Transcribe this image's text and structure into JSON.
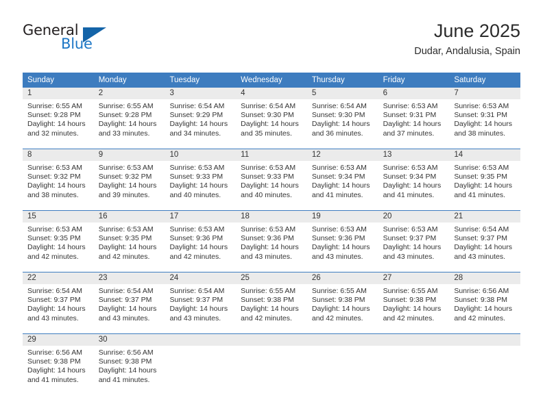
{
  "brand": {
    "name_primary": "General",
    "name_secondary": "Blue",
    "triangle_icon": "triangle-icon",
    "accent_color": "#1c76c5"
  },
  "header": {
    "title": "June 2025",
    "subtitle": "Dudar, Andalusia, Spain"
  },
  "colors": {
    "header_blue": "#3d7cbf",
    "day_band_gray": "#ebebeb",
    "text": "#333333"
  },
  "weekdays": [
    "Sunday",
    "Monday",
    "Tuesday",
    "Wednesday",
    "Thursday",
    "Friday",
    "Saturday"
  ],
  "labels": {
    "sunrise": "Sunrise:",
    "sunset": "Sunset:",
    "daylight": "Daylight:"
  },
  "weeks": [
    [
      {
        "day": "1",
        "sunrise": "Sunrise: 6:55 AM",
        "sunset": "Sunset: 9:28 PM",
        "daylight_1": "Daylight: 14 hours",
        "daylight_2": "and 32 minutes."
      },
      {
        "day": "2",
        "sunrise": "Sunrise: 6:55 AM",
        "sunset": "Sunset: 9:28 PM",
        "daylight_1": "Daylight: 14 hours",
        "daylight_2": "and 33 minutes."
      },
      {
        "day": "3",
        "sunrise": "Sunrise: 6:54 AM",
        "sunset": "Sunset: 9:29 PM",
        "daylight_1": "Daylight: 14 hours",
        "daylight_2": "and 34 minutes."
      },
      {
        "day": "4",
        "sunrise": "Sunrise: 6:54 AM",
        "sunset": "Sunset: 9:30 PM",
        "daylight_1": "Daylight: 14 hours",
        "daylight_2": "and 35 minutes."
      },
      {
        "day": "5",
        "sunrise": "Sunrise: 6:54 AM",
        "sunset": "Sunset: 9:30 PM",
        "daylight_1": "Daylight: 14 hours",
        "daylight_2": "and 36 minutes."
      },
      {
        "day": "6",
        "sunrise": "Sunrise: 6:53 AM",
        "sunset": "Sunset: 9:31 PM",
        "daylight_1": "Daylight: 14 hours",
        "daylight_2": "and 37 minutes."
      },
      {
        "day": "7",
        "sunrise": "Sunrise: 6:53 AM",
        "sunset": "Sunset: 9:31 PM",
        "daylight_1": "Daylight: 14 hours",
        "daylight_2": "and 38 minutes."
      }
    ],
    [
      {
        "day": "8",
        "sunrise": "Sunrise: 6:53 AM",
        "sunset": "Sunset: 9:32 PM",
        "daylight_1": "Daylight: 14 hours",
        "daylight_2": "and 38 minutes."
      },
      {
        "day": "9",
        "sunrise": "Sunrise: 6:53 AM",
        "sunset": "Sunset: 9:32 PM",
        "daylight_1": "Daylight: 14 hours",
        "daylight_2": "and 39 minutes."
      },
      {
        "day": "10",
        "sunrise": "Sunrise: 6:53 AM",
        "sunset": "Sunset: 9:33 PM",
        "daylight_1": "Daylight: 14 hours",
        "daylight_2": "and 40 minutes."
      },
      {
        "day": "11",
        "sunrise": "Sunrise: 6:53 AM",
        "sunset": "Sunset: 9:33 PM",
        "daylight_1": "Daylight: 14 hours",
        "daylight_2": "and 40 minutes."
      },
      {
        "day": "12",
        "sunrise": "Sunrise: 6:53 AM",
        "sunset": "Sunset: 9:34 PM",
        "daylight_1": "Daylight: 14 hours",
        "daylight_2": "and 41 minutes."
      },
      {
        "day": "13",
        "sunrise": "Sunrise: 6:53 AM",
        "sunset": "Sunset: 9:34 PM",
        "daylight_1": "Daylight: 14 hours",
        "daylight_2": "and 41 minutes."
      },
      {
        "day": "14",
        "sunrise": "Sunrise: 6:53 AM",
        "sunset": "Sunset: 9:35 PM",
        "daylight_1": "Daylight: 14 hours",
        "daylight_2": "and 41 minutes."
      }
    ],
    [
      {
        "day": "15",
        "sunrise": "Sunrise: 6:53 AM",
        "sunset": "Sunset: 9:35 PM",
        "daylight_1": "Daylight: 14 hours",
        "daylight_2": "and 42 minutes."
      },
      {
        "day": "16",
        "sunrise": "Sunrise: 6:53 AM",
        "sunset": "Sunset: 9:35 PM",
        "daylight_1": "Daylight: 14 hours",
        "daylight_2": "and 42 minutes."
      },
      {
        "day": "17",
        "sunrise": "Sunrise: 6:53 AM",
        "sunset": "Sunset: 9:36 PM",
        "daylight_1": "Daylight: 14 hours",
        "daylight_2": "and 42 minutes."
      },
      {
        "day": "18",
        "sunrise": "Sunrise: 6:53 AM",
        "sunset": "Sunset: 9:36 PM",
        "daylight_1": "Daylight: 14 hours",
        "daylight_2": "and 43 minutes."
      },
      {
        "day": "19",
        "sunrise": "Sunrise: 6:53 AM",
        "sunset": "Sunset: 9:36 PM",
        "daylight_1": "Daylight: 14 hours",
        "daylight_2": "and 43 minutes."
      },
      {
        "day": "20",
        "sunrise": "Sunrise: 6:53 AM",
        "sunset": "Sunset: 9:37 PM",
        "daylight_1": "Daylight: 14 hours",
        "daylight_2": "and 43 minutes."
      },
      {
        "day": "21",
        "sunrise": "Sunrise: 6:54 AM",
        "sunset": "Sunset: 9:37 PM",
        "daylight_1": "Daylight: 14 hours",
        "daylight_2": "and 43 minutes."
      }
    ],
    [
      {
        "day": "22",
        "sunrise": "Sunrise: 6:54 AM",
        "sunset": "Sunset: 9:37 PM",
        "daylight_1": "Daylight: 14 hours",
        "daylight_2": "and 43 minutes."
      },
      {
        "day": "23",
        "sunrise": "Sunrise: 6:54 AM",
        "sunset": "Sunset: 9:37 PM",
        "daylight_1": "Daylight: 14 hours",
        "daylight_2": "and 43 minutes."
      },
      {
        "day": "24",
        "sunrise": "Sunrise: 6:54 AM",
        "sunset": "Sunset: 9:37 PM",
        "daylight_1": "Daylight: 14 hours",
        "daylight_2": "and 43 minutes."
      },
      {
        "day": "25",
        "sunrise": "Sunrise: 6:55 AM",
        "sunset": "Sunset: 9:38 PM",
        "daylight_1": "Daylight: 14 hours",
        "daylight_2": "and 42 minutes."
      },
      {
        "day": "26",
        "sunrise": "Sunrise: 6:55 AM",
        "sunset": "Sunset: 9:38 PM",
        "daylight_1": "Daylight: 14 hours",
        "daylight_2": "and 42 minutes."
      },
      {
        "day": "27",
        "sunrise": "Sunrise: 6:55 AM",
        "sunset": "Sunset: 9:38 PM",
        "daylight_1": "Daylight: 14 hours",
        "daylight_2": "and 42 minutes."
      },
      {
        "day": "28",
        "sunrise": "Sunrise: 6:56 AM",
        "sunset": "Sunset: 9:38 PM",
        "daylight_1": "Daylight: 14 hours",
        "daylight_2": "and 42 minutes."
      }
    ],
    [
      {
        "day": "29",
        "sunrise": "Sunrise: 6:56 AM",
        "sunset": "Sunset: 9:38 PM",
        "daylight_1": "Daylight: 14 hours",
        "daylight_2": "and 41 minutes."
      },
      {
        "day": "30",
        "sunrise": "Sunrise: 6:56 AM",
        "sunset": "Sunset: 9:38 PM",
        "daylight_1": "Daylight: 14 hours",
        "daylight_2": "and 41 minutes."
      },
      {
        "day": "",
        "sunrise": "",
        "sunset": "",
        "daylight_1": "",
        "daylight_2": ""
      },
      {
        "day": "",
        "sunrise": "",
        "sunset": "",
        "daylight_1": "",
        "daylight_2": ""
      },
      {
        "day": "",
        "sunrise": "",
        "sunset": "",
        "daylight_1": "",
        "daylight_2": ""
      },
      {
        "day": "",
        "sunrise": "",
        "sunset": "",
        "daylight_1": "",
        "daylight_2": ""
      },
      {
        "day": "",
        "sunrise": "",
        "sunset": "",
        "daylight_1": "",
        "daylight_2": ""
      }
    ]
  ]
}
